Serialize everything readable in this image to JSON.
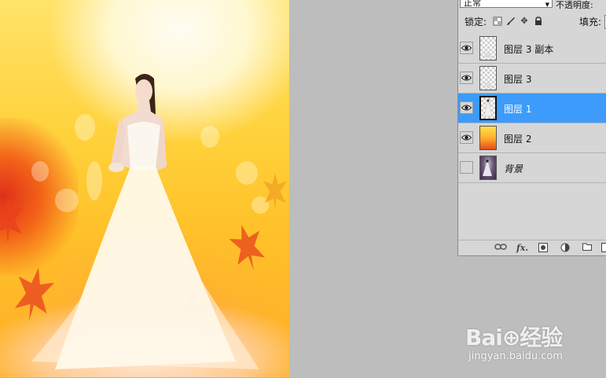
{
  "layers_panel": {
    "blend_mode": "正常",
    "opacity_label": "不透明度:",
    "lock_label": "锁定:",
    "fill_label": "填充:",
    "layers": [
      {
        "name": "图层 3 副本",
        "visible": true,
        "selected": false,
        "thumb": "transparent"
      },
      {
        "name": "图层 3",
        "visible": true,
        "selected": false,
        "thumb": "transparent"
      },
      {
        "name": "图层 1",
        "visible": true,
        "selected": true,
        "thumb": "transparent"
      },
      {
        "name": "图层 2",
        "visible": true,
        "selected": false,
        "thumb": "fire"
      },
      {
        "name": "背景",
        "visible": false,
        "selected": false,
        "thumb": "background"
      }
    ],
    "footer_icons": [
      "link-icon",
      "fx-icon",
      "mask-icon",
      "adjustment-icon",
      "folder-icon",
      "new-layer-icon"
    ],
    "selected_color": "#3d9bfb"
  },
  "watermark": {
    "brand": "Bai⊕经验",
    "url": "jingyan.baidu.com"
  }
}
